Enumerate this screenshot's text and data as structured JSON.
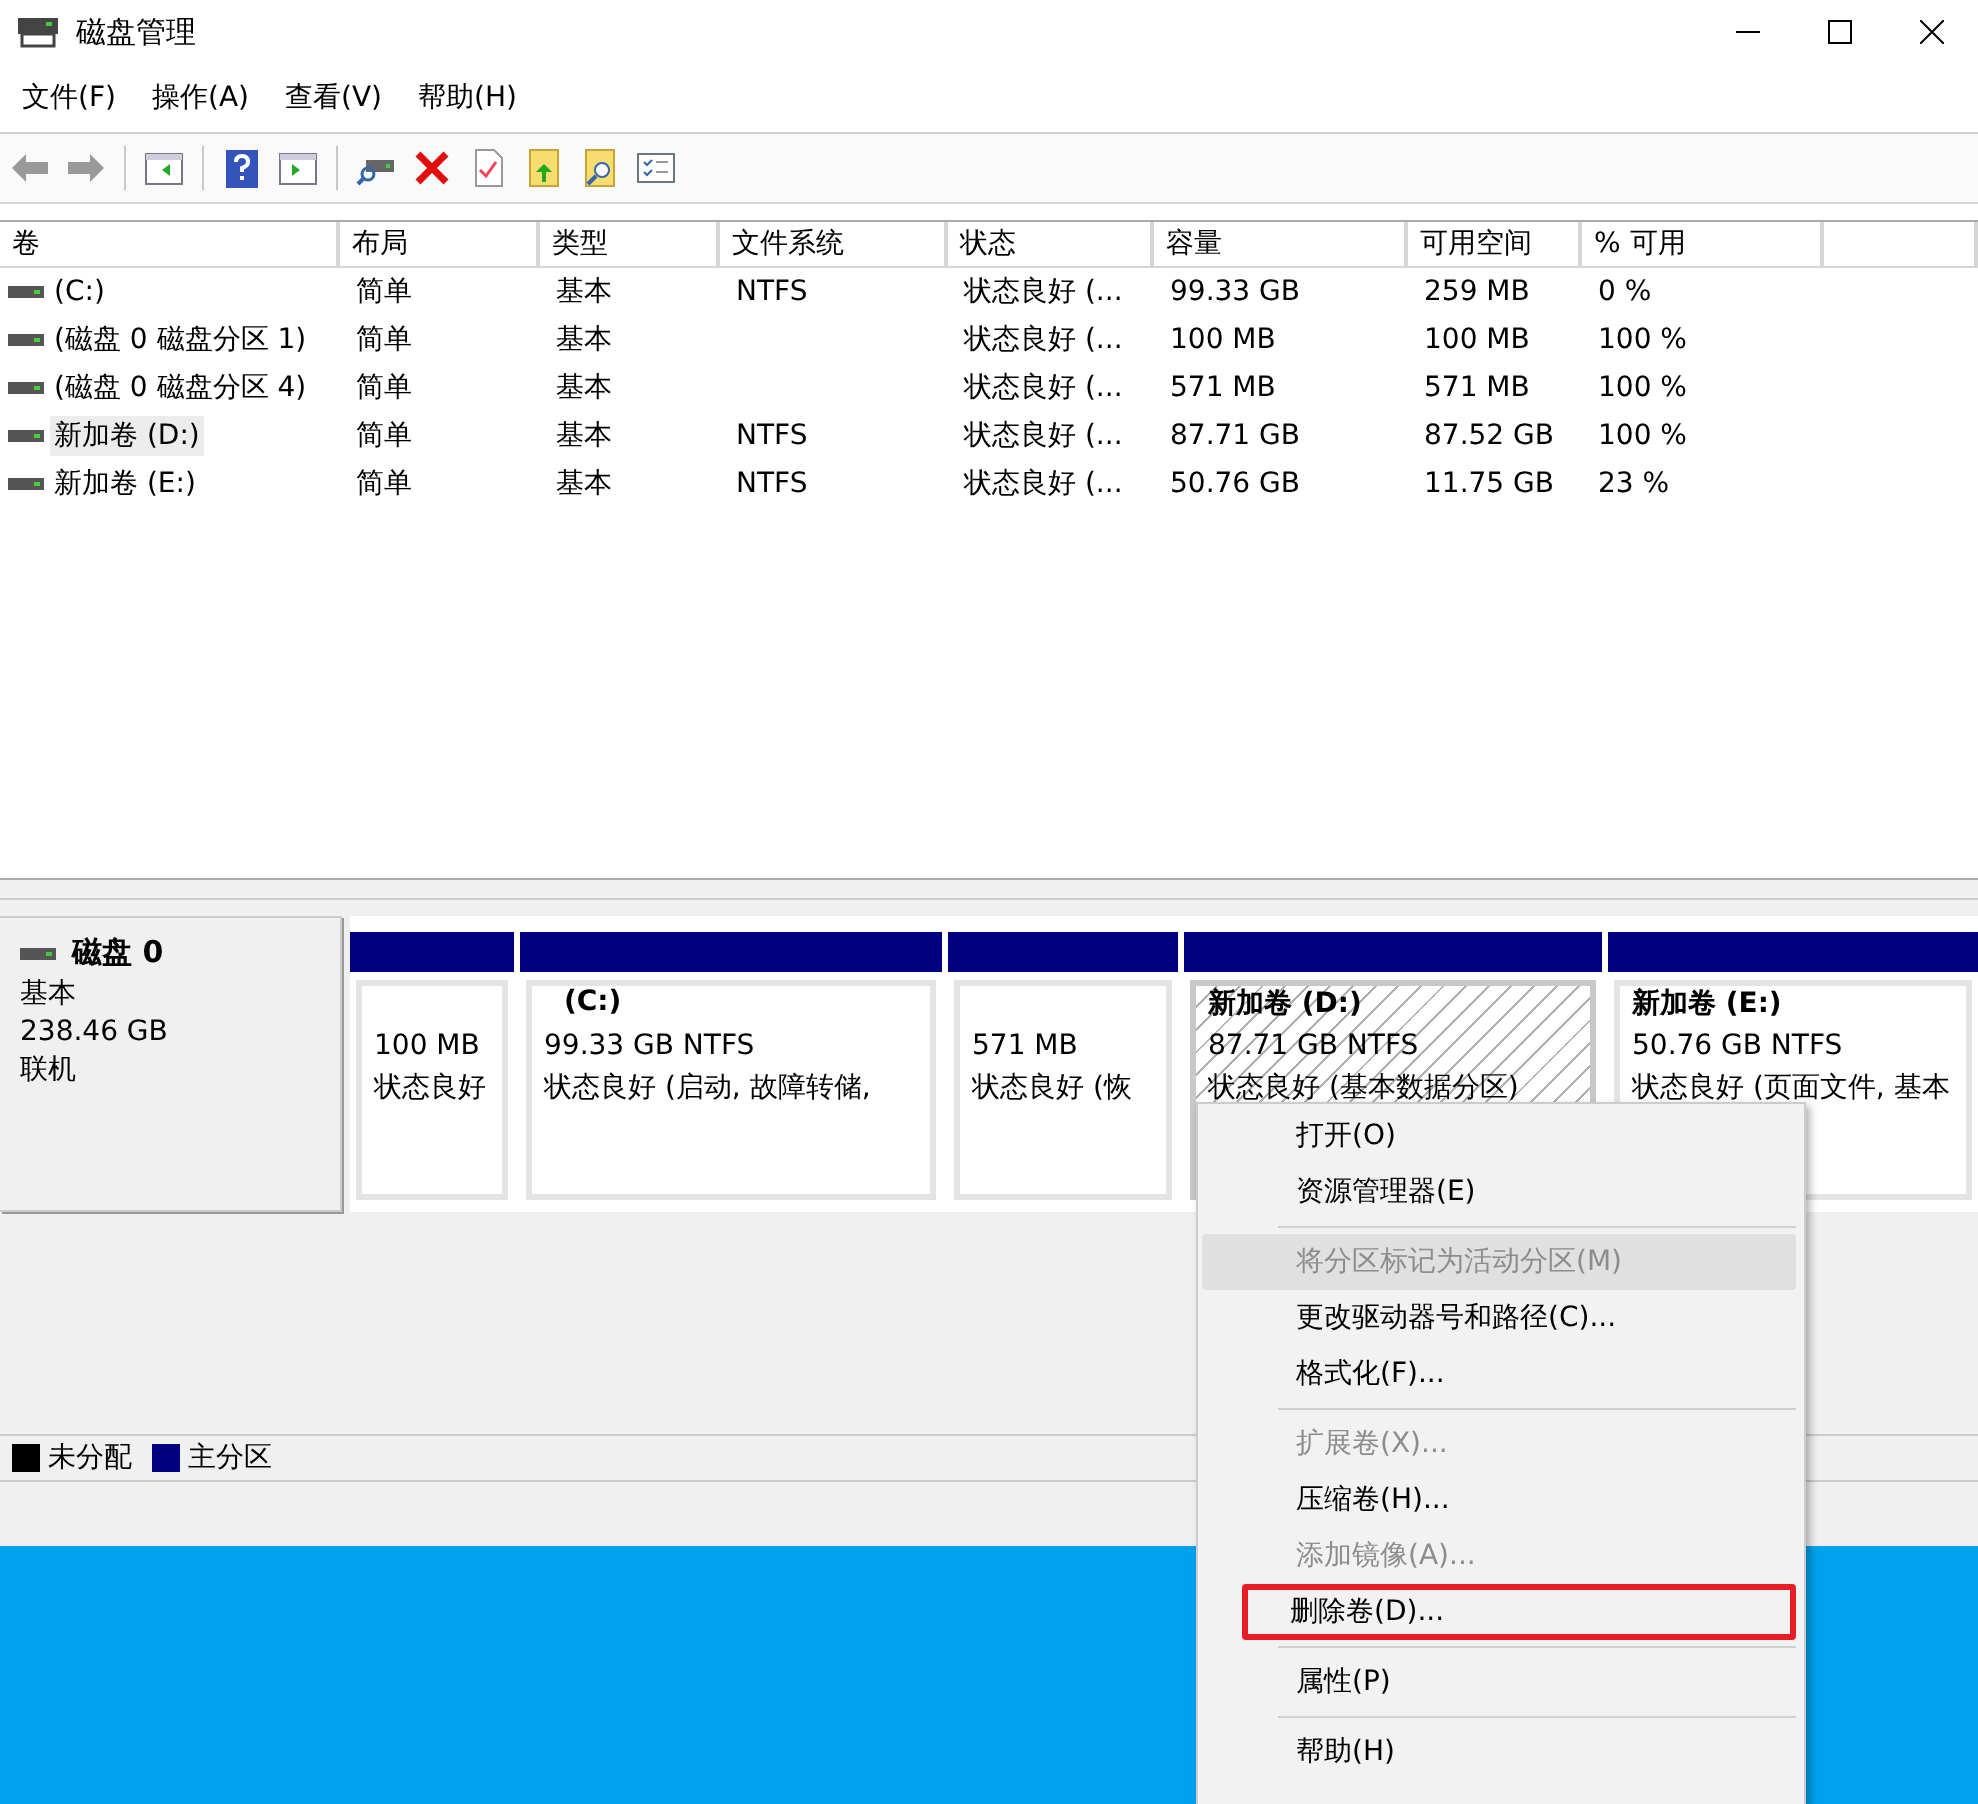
{
  "window": {
    "title": "磁盘管理"
  },
  "menu_bar": [
    "文件(F)",
    "操作(A)",
    "查看(V)",
    "帮助(H)"
  ],
  "volume_table": {
    "columns": [
      "卷",
      "布局",
      "类型",
      "文件系统",
      "状态",
      "容量",
      "可用空间",
      "% 可用"
    ],
    "rows": [
      {
        "selected": false,
        "cells": [
          " (C:)",
          "简单",
          "基本",
          "NTFS",
          "状态良好 (...",
          "99.33 GB",
          "259 MB",
          "0 %"
        ]
      },
      {
        "selected": false,
        "cells": [
          "(磁盘 0 磁盘分区 1)",
          "简单",
          "基本",
          "",
          "状态良好 (...",
          "100 MB",
          "100 MB",
          "100 %"
        ]
      },
      {
        "selected": false,
        "cells": [
          "(磁盘 0 磁盘分区 4)",
          "简单",
          "基本",
          "",
          "状态良好 (...",
          "571 MB",
          "571 MB",
          "100 %"
        ]
      },
      {
        "selected": true,
        "cells": [
          "新加卷 (D:)",
          "简单",
          "基本",
          "NTFS",
          "状态良好 (...",
          "87.71 GB",
          "87.52 GB",
          "100 %"
        ]
      },
      {
        "selected": false,
        "cells": [
          "新加卷 (E:)",
          "简单",
          "基本",
          "NTFS",
          "状态良好 (...",
          "50.76 GB",
          "11.75 GB",
          "23 %"
        ]
      }
    ]
  },
  "disk": {
    "name": "磁盘 0",
    "type": "基本",
    "size": "238.46 GB",
    "state": "联机",
    "partitions": [
      {
        "selected": false,
        "size": "100 MB",
        "status": "状态良好"
      },
      {
        "selected": false,
        "title": "(C:)",
        "size": "99.33 GB NTFS",
        "status": "状态良好 (启动, 故障转储,"
      },
      {
        "selected": false,
        "size": "571 MB",
        "status": "状态良好 (恢"
      },
      {
        "selected": true,
        "title": "新加卷 (D:)",
        "size": "87.71 GB NTFS",
        "status": "状态良好 (基本数据分区)"
      },
      {
        "selected": false,
        "title": "新加卷 (E:)",
        "size": "50.76 GB NTFS",
        "status": "状态良好 (页面文件, 基本"
      }
    ]
  },
  "legend": [
    {
      "label": "未分配",
      "color": "#000000"
    },
    {
      "label": "主分区",
      "color": "#000080"
    }
  ],
  "context_menu": [
    {
      "kind": "item",
      "label": "打开(O)",
      "disabled": false,
      "selected": false,
      "marked": false
    },
    {
      "kind": "item",
      "label": "资源管理器(E)",
      "disabled": false,
      "selected": false,
      "marked": false
    },
    {
      "kind": "separator"
    },
    {
      "kind": "item",
      "label": "将分区标记为活动分区(M)",
      "disabled": true,
      "selected": true,
      "marked": false
    },
    {
      "kind": "item",
      "label": "更改驱动器号和路径(C)...",
      "disabled": false,
      "selected": false,
      "marked": false
    },
    {
      "kind": "item",
      "label": "格式化(F)...",
      "disabled": false,
      "selected": false,
      "marked": false
    },
    {
      "kind": "separator"
    },
    {
      "kind": "item",
      "label": "扩展卷(X)...",
      "disabled": true,
      "selected": false,
      "marked": false
    },
    {
      "kind": "item",
      "label": "压缩卷(H)...",
      "disabled": false,
      "selected": false,
      "marked": false
    },
    {
      "kind": "item",
      "label": "添加镜像(A)...",
      "disabled": true,
      "selected": false,
      "marked": false
    },
    {
      "kind": "item",
      "label": "删除卷(D)...",
      "disabled": false,
      "selected": false,
      "marked": true
    },
    {
      "kind": "separator"
    },
    {
      "kind": "item",
      "label": "属性(P)",
      "disabled": false,
      "selected": false,
      "marked": false
    },
    {
      "kind": "separator"
    },
    {
      "kind": "item",
      "label": "帮助(H)",
      "disabled": false,
      "selected": false,
      "marked": false
    }
  ]
}
